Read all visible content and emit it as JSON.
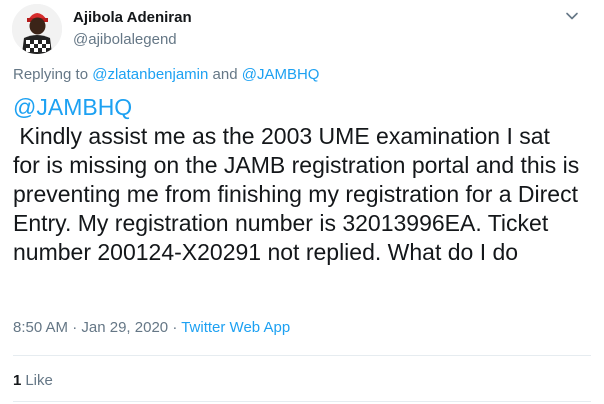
{
  "user": {
    "display_name": "Ajibola Adeniran",
    "handle": "@ajibolalegend"
  },
  "reply": {
    "prefix": "Replying to",
    "mention_1": "@zlatanbenjamin",
    "conjunction": "and",
    "mention_2": "@JAMBHQ"
  },
  "tweet": {
    "mention": "@JAMBHQ",
    "text": " Kindly assist me as the 2003 UME examination I sat for is missing on the JAMB registration portal and this is preventing me from finishing my registration for a Direct Entry. My registration number is 32013996EA. Ticket number 200124-X20291 not replied. What do I do"
  },
  "meta": {
    "time": "8:50 AM",
    "separator": "·",
    "date": "Jan 29, 2020",
    "source": "Twitter Web App"
  },
  "stats": {
    "like_count": "1",
    "like_label": "Like"
  },
  "colors": {
    "link": "#1da1f2",
    "secondary_text": "#657786",
    "primary_text": "#14171a",
    "divider": "#e6ecf0"
  },
  "icons": {
    "caret": "chevron-down-icon"
  }
}
